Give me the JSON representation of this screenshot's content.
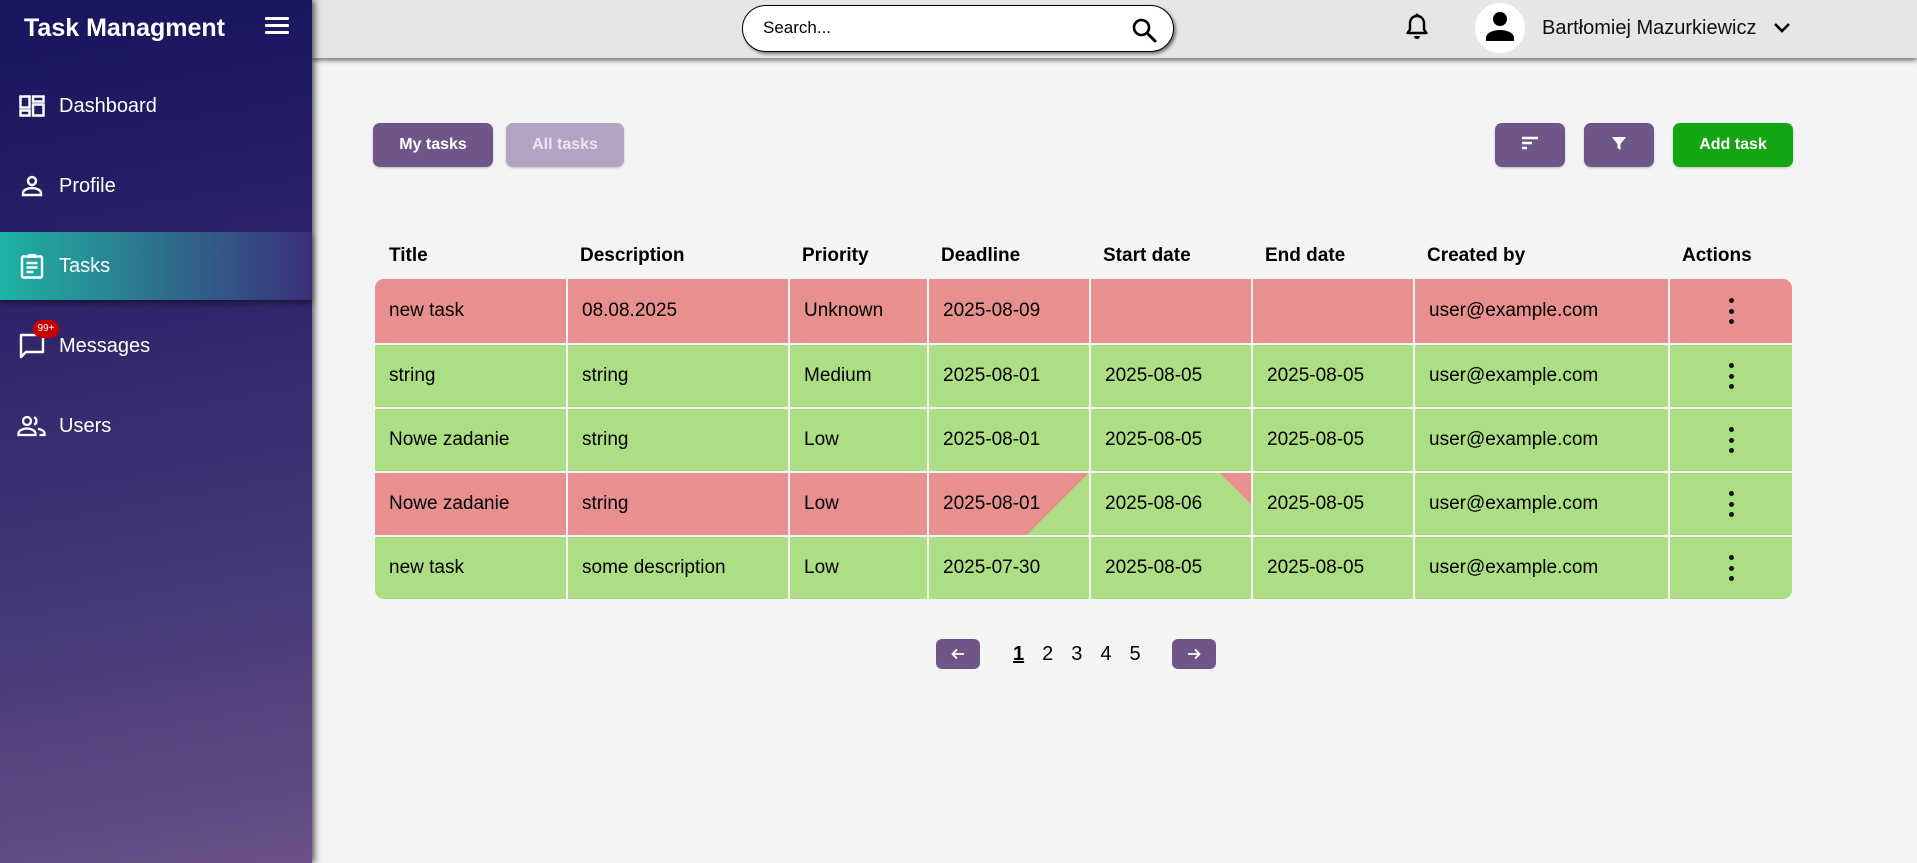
{
  "app": {
    "brand": "Task Managment"
  },
  "sidebar": {
    "items": [
      {
        "label": "Dashboard",
        "icon": "dashboard-icon"
      },
      {
        "label": "Profile",
        "icon": "person-icon"
      },
      {
        "label": "Tasks",
        "icon": "clipboard-icon",
        "active": true
      },
      {
        "label": "Messages",
        "icon": "chat-icon",
        "badge": "99+"
      },
      {
        "label": "Users",
        "icon": "users-icon"
      }
    ]
  },
  "header": {
    "search_placeholder": "Search...",
    "user_name": "Bartłomiej Mazurkiewicz"
  },
  "toolbar": {
    "my_tasks": "My tasks",
    "all_tasks": "All tasks",
    "add_task": "Add task"
  },
  "table": {
    "columns": [
      "Title",
      "Description",
      "Priority",
      "Deadline",
      "Start date",
      "End date",
      "Created by",
      "Actions"
    ],
    "rows": [
      {
        "status": "red",
        "title": "new task",
        "description": "08.08.2025",
        "priority": "Unknown",
        "deadline": "2025-08-09",
        "start": "",
        "end": "",
        "created_by": "user@example.com"
      },
      {
        "status": "green",
        "title": "string",
        "description": "string",
        "priority": "Medium",
        "deadline": "2025-08-01",
        "start": "2025-08-05",
        "end": "2025-08-05",
        "created_by": "user@example.com"
      },
      {
        "status": "green",
        "title": "Nowe zadanie",
        "description": "string",
        "priority": "Low",
        "deadline": "2025-08-01",
        "start": "2025-08-05",
        "end": "2025-08-05",
        "created_by": "user@example.com"
      },
      {
        "status": "split",
        "title": "Nowe zadanie",
        "description": "string",
        "priority": "Low",
        "deadline": "2025-08-01",
        "start": "2025-08-06",
        "end": "2025-08-05",
        "created_by": "user@example.com"
      },
      {
        "status": "green",
        "title": "new task",
        "description": "some description",
        "priority": "Low",
        "deadline": "2025-07-30",
        "start": "2025-08-05",
        "end": "2025-08-05",
        "created_by": "user@example.com"
      }
    ]
  },
  "pagination": {
    "pages": [
      "1",
      "2",
      "3",
      "4",
      "5"
    ],
    "current": "1"
  },
  "colors": {
    "red_row": "#e89090",
    "green_row": "#acdf84",
    "purple": "#6f5688",
    "green_button": "#14a514"
  }
}
